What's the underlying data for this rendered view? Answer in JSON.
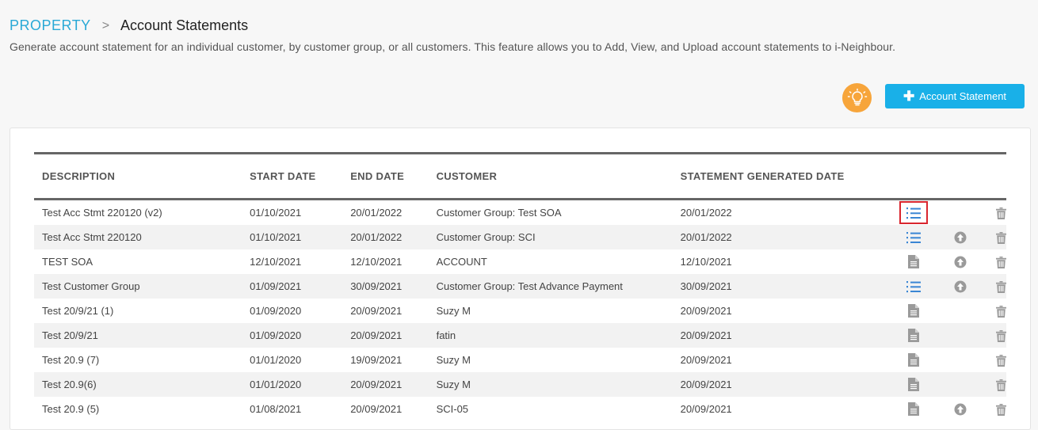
{
  "breadcrumb": {
    "root": "PROPERTY",
    "separator": ">",
    "title": "Account Statements"
  },
  "description": "Generate account statement for an individual customer, by customer group, or all customers. This feature allows you to Add, View, and Upload account statements to i-Neighbour.",
  "toolbar": {
    "tips_icon": "lightbulb-icon",
    "add_label": "Account Statement"
  },
  "table": {
    "columns": [
      "DESCRIPTION",
      "START DATE",
      "END DATE",
      "CUSTOMER",
      "STATEMENT GENERATED DATE"
    ],
    "rows": [
      {
        "description": "Test Acc Stmt 220120 (v2)",
        "start": "01/10/2021",
        "end": "20/01/2022",
        "customer": "Customer Group: Test SOA",
        "generated": "20/01/2022",
        "view_icon": "list-icon",
        "upload": false
      },
      {
        "description": "Test Acc Stmt 220120",
        "start": "01/10/2021",
        "end": "20/01/2022",
        "customer": "Customer Group: SCI",
        "generated": "20/01/2022",
        "view_icon": "list-icon",
        "upload": true
      },
      {
        "description": "TEST SOA",
        "start": "12/10/2021",
        "end": "12/10/2021",
        "customer": "ACCOUNT",
        "generated": "12/10/2021",
        "view_icon": "document-icon",
        "upload": true
      },
      {
        "description": "Test Customer Group",
        "start": "01/09/2021",
        "end": "30/09/2021",
        "customer": "Customer Group: Test Advance Payment",
        "generated": "30/09/2021",
        "view_icon": "list-icon",
        "upload": true
      },
      {
        "description": "Test 20/9/21 (1)",
        "start": "01/09/2020",
        "end": "20/09/2021",
        "customer": "Suzy M",
        "generated": "20/09/2021",
        "view_icon": "document-icon",
        "upload": false
      },
      {
        "description": "Test 20/9/21",
        "start": "01/09/2020",
        "end": "20/09/2021",
        "customer": "fatin",
        "generated": "20/09/2021",
        "view_icon": "document-icon",
        "upload": false
      },
      {
        "description": "Test 20.9 (7)",
        "start": "01/01/2020",
        "end": "19/09/2021",
        "customer": "Suzy M",
        "generated": "20/09/2021",
        "view_icon": "document-icon",
        "upload": false
      },
      {
        "description": "Test 20.9(6)",
        "start": "01/01/2020",
        "end": "20/09/2021",
        "customer": "Suzy M",
        "generated": "20/09/2021",
        "view_icon": "document-icon",
        "upload": false
      },
      {
        "description": "Test 20.9 (5)",
        "start": "01/08/2021",
        "end": "20/09/2021",
        "customer": "SCI-05",
        "generated": "20/09/2021",
        "view_icon": "document-icon",
        "upload": true
      }
    ]
  },
  "colors": {
    "accent": "#19b0e8",
    "breadcrumb": "#2aa9d6",
    "bulb": "#f7a53b",
    "highlight": "#d9262e",
    "list_icon": "#3a86d4",
    "icon_gray": "#9a9a9a"
  }
}
